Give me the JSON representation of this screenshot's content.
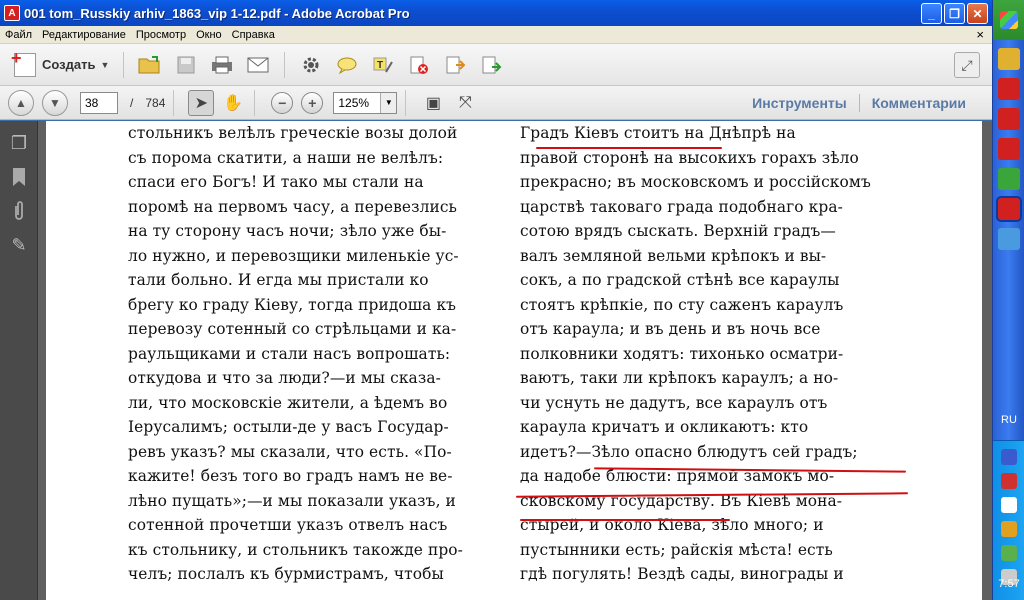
{
  "window": {
    "title": "001 tom_Russkiy arhiv_1863_vip 1-12.pdf - Adobe Acrobat Pro",
    "app_icon_text": "A",
    "btn_minimize": "_",
    "btn_maximize": "❐",
    "btn_close": "✕"
  },
  "menubar": {
    "items": [
      "Файл",
      "Редактирование",
      "Просмотр",
      "Окно",
      "Справка"
    ],
    "close_glyph": "×"
  },
  "toolbar1": {
    "create_label": "Создать",
    "create_caret": "▼",
    "icons": [
      "open-icon",
      "save-icon",
      "print-icon",
      "email-icon",
      "settings-icon",
      "comment-icon",
      "highlight-icon",
      "delete-page-icon",
      "extract-icon",
      "export-icon"
    ],
    "expand_glyph": "⤢"
  },
  "toolbar2": {
    "prev_glyph": "▲",
    "next_glyph": "▼",
    "current_page": "38",
    "page_separator": "/",
    "total_pages": "784",
    "select_glyph": "➤",
    "hand_glyph": "✋",
    "zoom_out_glyph": "−",
    "zoom_in_glyph": "+",
    "zoom_value": "125%",
    "zoom_caret": "▼",
    "fit_page_glyph": "▣",
    "fit_width_glyph": "⤧",
    "tools_link": "Инструменты",
    "comments_link": "Комментарии"
  },
  "leftpanel": {
    "icons": [
      "pages-icon",
      "bookmarks-icon",
      "attachments-icon",
      "signatures-icon"
    ],
    "glyphs": [
      "❐",
      "🔖",
      "📎",
      "✎"
    ]
  },
  "document": {
    "left_top_partial": "",
    "right_top_partial": "",
    "left_lines": [
      "стольникъ велѣлъ греческіе возы долой",
      "съ порома скатити, а наши не велѣлъ:",
      "спаси его Богъ! И тако мы стали на",
      "поромѣ на первомъ часу, а перевезлись",
      "на ту сторону часъ ночи; зѣло уже бы-",
      "ло нужно, и перевозщики миленькіе ус-",
      "тали больно. И егда мы пристали ко",
      "брегу ко граду Кіеву, тогда придоша къ",
      "перевозу сотенный со стрѣльцами и ка-",
      "раульщиками и стали насъ вопрошать:",
      "откудова и что за люди?—и мы сказа-",
      "ли, что московскіе жители, а ѣдемъ во",
      "Іерусалимъ; остыли-де у васъ Государ-",
      "ревъ указъ? мы сказали, что есть. «По-",
      "кажите! безъ того во градъ намъ не ве-",
      "лѣно пущать»;—и мы показали указъ, и",
      "сотенной прочетши указъ отвелъ насъ",
      "къ стольнику, и стольникъ такожде про-",
      "челъ; послалъ къ бурмистрамъ, чтобы"
    ],
    "right_lines": [
      "Градъ Кіевъ стоитъ на Днѣпрѣ на",
      "правой сторонѣ на высокихъ горахъ зѣло",
      "прекрасно; въ московскомъ и россійскомъ",
      "царствѣ таковаго града подобнаго кра-",
      "сотою врядъ сыскать. Верхній градъ—",
      "валъ земляной вельми крѣпокъ и вы-",
      "сокъ, а по градской стѣнѣ все караулы",
      "стоятъ крѣпкіе, по сту саженъ караулъ",
      "отъ караула; и въ день и въ ночь все",
      "полковники ходятъ: тихонько осматри-",
      "ваютъ, таки ли крѣпокъ караулъ; а но-",
      "чи уснуть не дадутъ, все караулъ отъ",
      "караула кричатъ и окликаютъ: кто",
      "идетъ?—Зѣло опасно блюдутъ сей градъ;",
      "да надобе блюсти: прямой замокъ мо-",
      "сковскому государству. Въ Кіевѣ мона-",
      "стырей, и около Кіева, зѣло много; и",
      "пустынники есть; райскія мѣста! есть",
      "гдѣ погулять! Вездѣ сады, винограды и"
    ]
  },
  "taskbar": {
    "lang": "RU",
    "clock": "7:57"
  }
}
